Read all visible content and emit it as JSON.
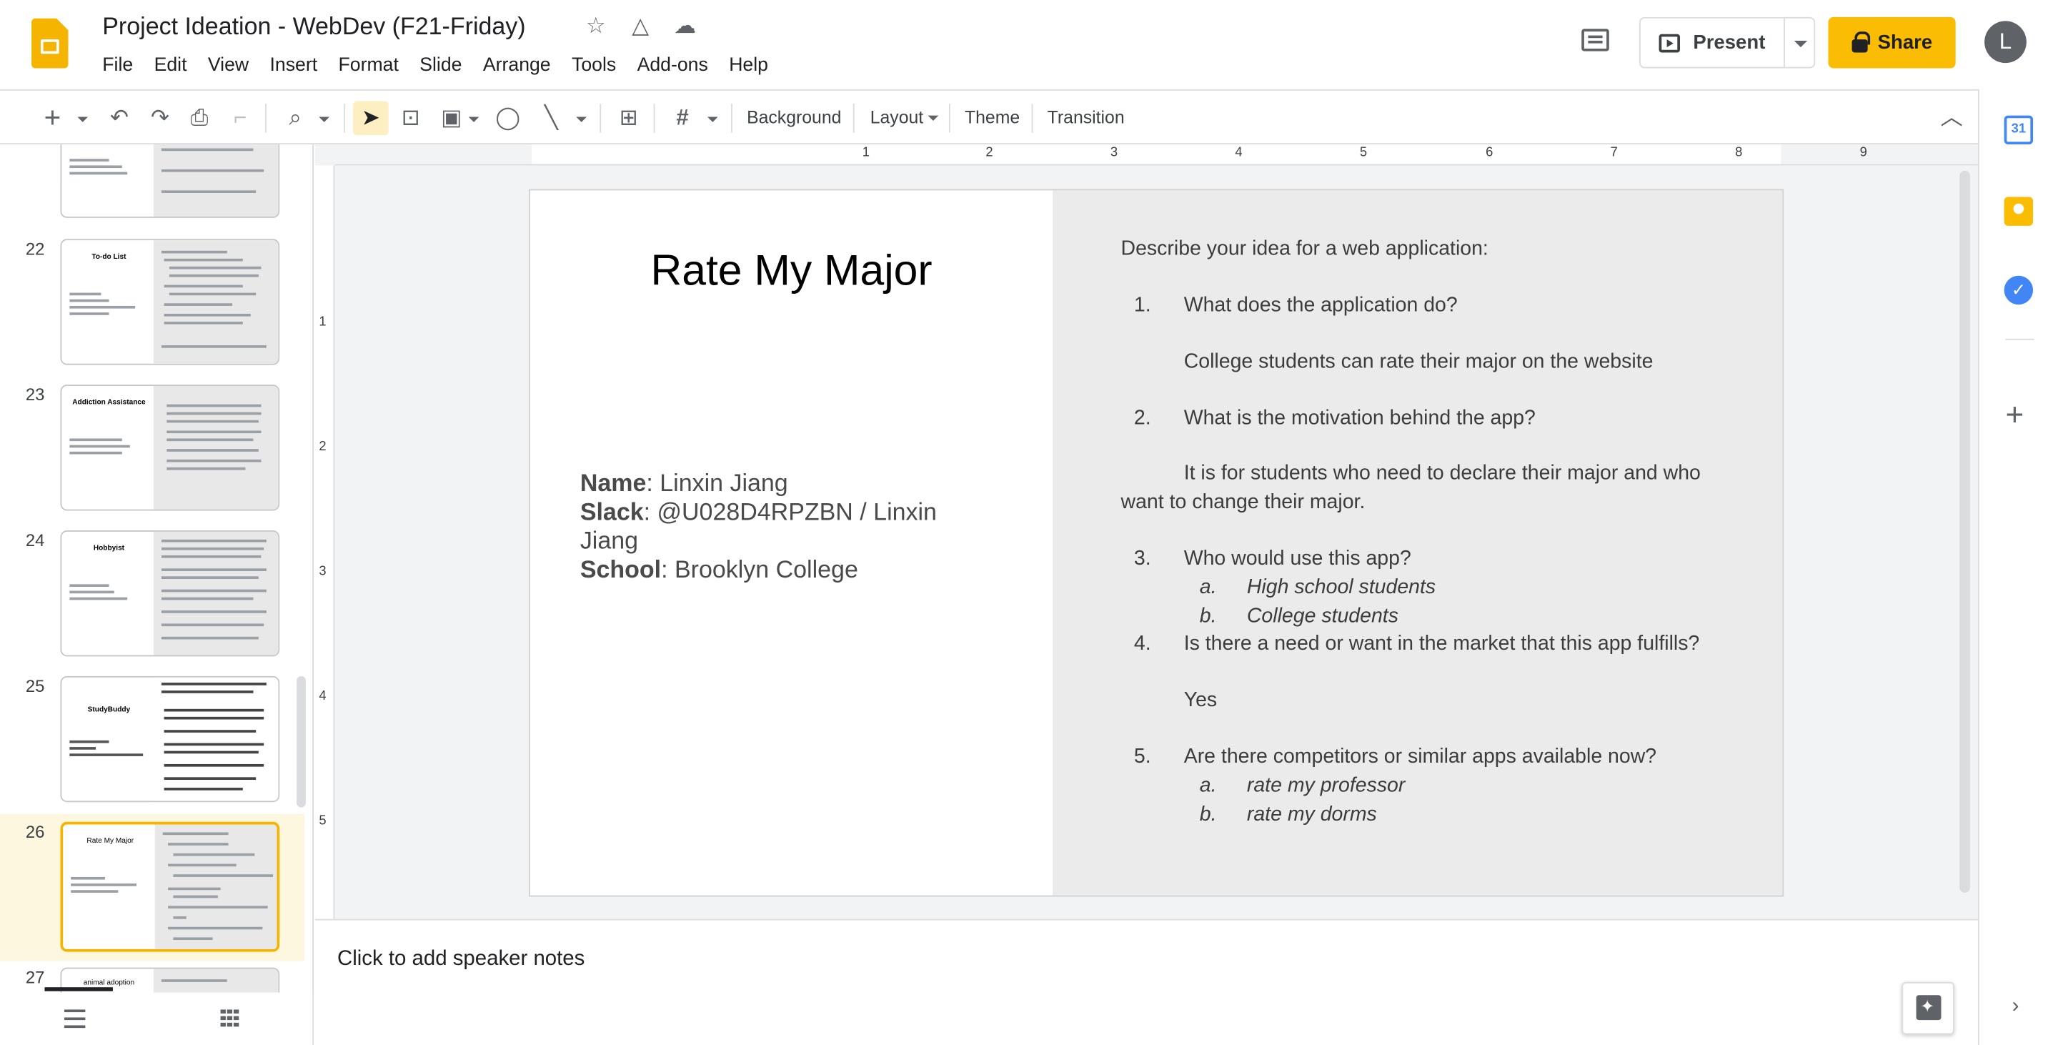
{
  "header": {
    "doc_title": "Project Ideation - WebDev (F21-Friday)",
    "menu": [
      "File",
      "Edit",
      "View",
      "Insert",
      "Format",
      "Slide",
      "Arrange",
      "Tools",
      "Add-ons",
      "Help"
    ],
    "present_label": "Present",
    "share_label": "Share",
    "avatar_initial": "L"
  },
  "toolbar": {
    "background_label": "Background",
    "layout_label": "Layout",
    "theme_label": "Theme",
    "transition_label": "Transition"
  },
  "filmstrip": {
    "slides": [
      {
        "number": "22",
        "title": "To-do List"
      },
      {
        "number": "23",
        "title": "Addiction Assistance"
      },
      {
        "number": "24",
        "title": "Hobbyist"
      },
      {
        "number": "25",
        "title": "StudyBuddy"
      },
      {
        "number": "26",
        "title": "Rate My Major"
      },
      {
        "number": "27",
        "title": "animal adoption"
      }
    ],
    "selected_slide": "26"
  },
  "ruler": {
    "h_numbers": [
      "1",
      "1",
      "2",
      "3",
      "4",
      "5",
      "6",
      "7",
      "8",
      "9"
    ],
    "v_numbers": [
      "1",
      "2",
      "3",
      "4",
      "5"
    ]
  },
  "slide": {
    "title": "Rate My Major",
    "info": {
      "name_label": "Name",
      "name_value": ": Linxin Jiang",
      "slack_label": "Slack",
      "slack_value": ": @U028D4RPZBN / Linxin Jiang",
      "school_label": "School",
      "school_value": ": Brooklyn College"
    },
    "right": {
      "intro": "Describe your idea for a web application:",
      "q1_num": "1.",
      "q1": "What does the application do?",
      "a1": "College students can rate their major on the website",
      "q2_num": "2.",
      "q2": "What is the motivation behind the app?",
      "a2_line1": "It is for students who need to declare their major and who",
      "a2_line2": "want to change their major.",
      "q3_num": "3.",
      "q3": "Who would use this app?",
      "q3a_mark": "a.",
      "q3a": "High school students",
      "q3b_mark": "b.",
      "q3b": "College students",
      "q4_num": "4.",
      "q4": "Is there a need or want in the market that this app fulfills?",
      "a4": "Yes",
      "q5_num": "5.",
      "q5": "Are there competitors or similar apps available now?",
      "q5a_mark": "a.",
      "q5a": "rate my professor",
      "q5b_mark": "b.",
      "q5b": "rate my dorms"
    }
  },
  "notes": {
    "placeholder": "Click to add speaker notes"
  },
  "side_panel": {
    "calendar_day": "31"
  },
  "colors": {
    "accent": "#fbbc04",
    "selected_thumb_border": "#f4b400",
    "slide_right_bg": "#ebebeb"
  }
}
